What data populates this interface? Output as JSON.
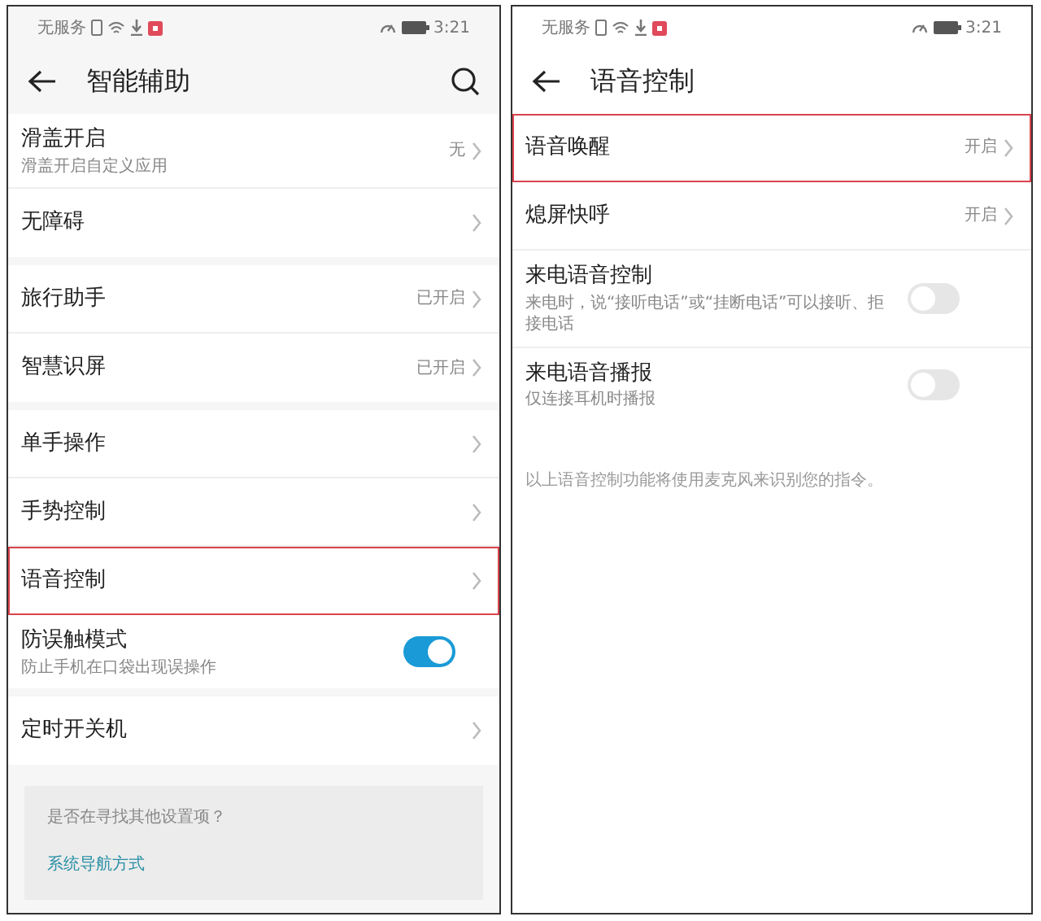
{
  "screens": [
    {
      "status_bar": {
        "carrier": "无服务",
        "time": "3:21"
      },
      "title": "智能辅助",
      "search": true,
      "groups": [
        [
          {
            "kind": "link",
            "label": "滑盖开启",
            "sublabel": "滑盖开启自定义应用",
            "value": "无",
            "highlighted": false
          },
          {
            "kind": "link",
            "label": "无障碍",
            "highlighted": false
          }
        ],
        [
          {
            "kind": "link",
            "label": "旅行助手",
            "value": "已开启",
            "highlighted": false
          },
          {
            "kind": "link",
            "label": "智慧识屏",
            "value": "已开启",
            "highlighted": false
          }
        ],
        [
          {
            "kind": "link",
            "label": "单手操作",
            "highlighted": false
          },
          {
            "kind": "link",
            "label": "手势控制",
            "highlighted": false
          },
          {
            "kind": "link",
            "label": "语音控制",
            "highlighted": true
          },
          {
            "kind": "toggle",
            "label": "防误触模式",
            "sublabel": "防止手机在口袋出现误操作",
            "on": true,
            "highlighted": false
          }
        ],
        [
          {
            "kind": "link",
            "label": "定时开关机",
            "highlighted": false
          }
        ]
      ],
      "suggestion": {
        "question": "是否在寻找其他设置项？",
        "link": "系统导航方式"
      }
    },
    {
      "status_bar": {
        "carrier": "无服务",
        "time": "3:21"
      },
      "title": "语音控制",
      "search": false,
      "groups": [
        [
          {
            "kind": "link",
            "label": "语音唤醒",
            "value": "开启",
            "highlighted": true
          },
          {
            "kind": "link",
            "label": "熄屏快呼",
            "value": "开启",
            "highlighted": false
          },
          {
            "kind": "toggle",
            "label": "来电语音控制",
            "sublabel": "来电时，说“接听电话”或“挂断电话”可以接听、拒接电话",
            "on": false,
            "highlighted": false
          },
          {
            "kind": "toggle",
            "label": "来电语音播报",
            "sublabel": "仅连接耳机时播报",
            "on": false,
            "highlighted": false
          }
        ]
      ],
      "footnote": "以上语音控制功能将使用麦克风来识别您的指令。"
    }
  ]
}
